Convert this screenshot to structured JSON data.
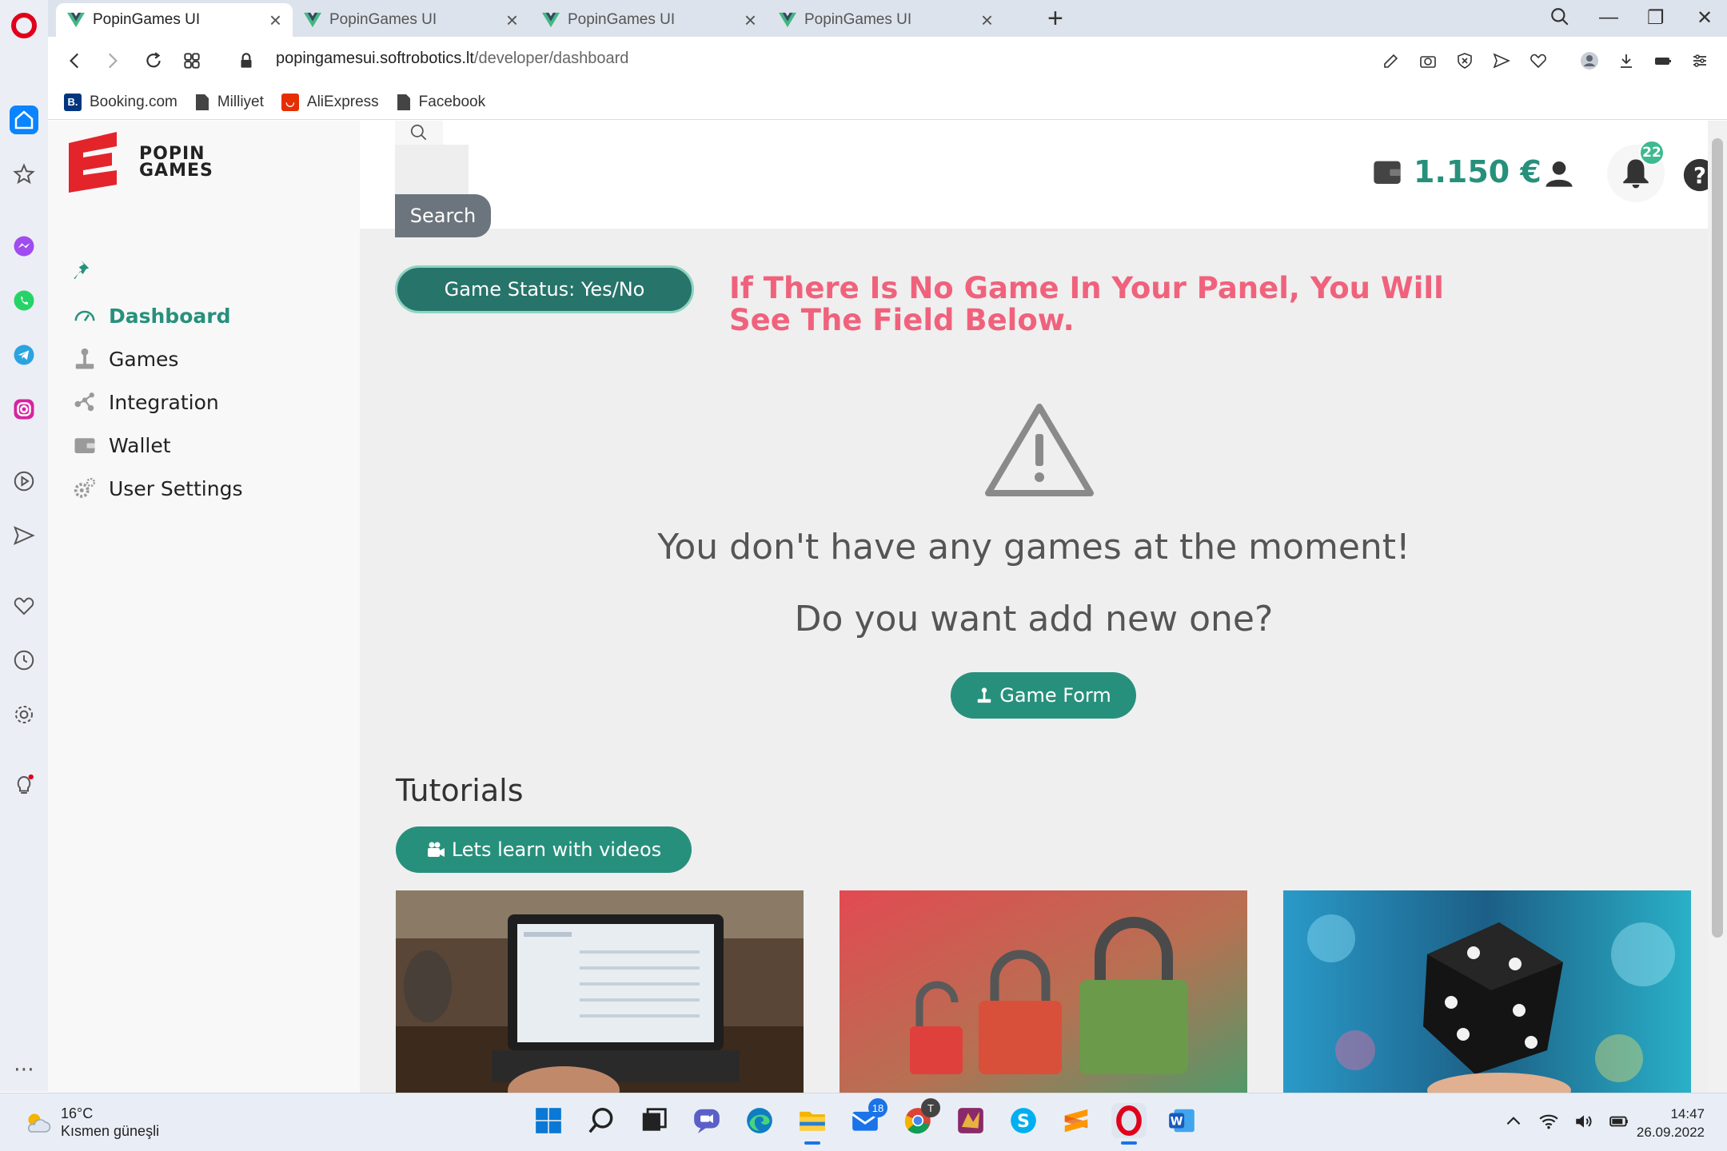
{
  "browser": {
    "tabs": [
      {
        "title": "PopinGames UI",
        "active": true
      },
      {
        "title": "PopinGames UI",
        "active": false
      },
      {
        "title": "PopinGames UI",
        "active": false
      },
      {
        "title": "PopinGames UI",
        "active": false
      }
    ],
    "url_host": "popingamesui.softrobotics.lt",
    "url_path": "/developer/dashboard",
    "bookmarks": [
      {
        "label": "Booking.com",
        "icon": "booking-icon",
        "color": "#003580"
      },
      {
        "label": "Milliyet",
        "icon": "page-icon",
        "color": "#444444"
      },
      {
        "label": "AliExpress",
        "icon": "aliexpress-icon",
        "color": "#e62e04"
      },
      {
        "label": "Facebook",
        "icon": "page-icon",
        "color": "#444444"
      }
    ]
  },
  "app": {
    "logo_line1": "POPIN",
    "logo_line2": "GAMES",
    "brand_color": "#27907c",
    "sidebar": {
      "items": [
        {
          "label": "Dashboard",
          "icon": "gauge-icon",
          "active": true
        },
        {
          "label": "Games",
          "icon": "joystick-icon",
          "active": false
        },
        {
          "label": "Integration",
          "icon": "network-icon",
          "active": false
        },
        {
          "label": "Wallet",
          "icon": "wallet-icon",
          "active": false
        },
        {
          "label": "User Settings",
          "icon": "gears-icon",
          "active": false
        }
      ]
    },
    "header": {
      "search_button": "Search",
      "balance": "1.150 €",
      "notification_count": "22"
    },
    "main": {
      "status_button": "Game Status: Yes/No",
      "note": "If There Is No Game In Your Panel, You Will See The Field Below.",
      "note_color": "#f0627c",
      "empty_title": "You don't have any games at the moment!",
      "empty_subtitle": "Do you want add new one?",
      "game_form_button": "Game Form",
      "tutorials_title": "Tutorials",
      "videos_button": "Lets learn with videos",
      "tutorial_images": [
        "laptop-photo",
        "padlocks-photo",
        "dice-photo"
      ]
    }
  },
  "taskbar": {
    "weather_temp": "16°C",
    "weather_desc": "Kısmen güneşli",
    "mail_badge": "18",
    "chrome_badge": "T",
    "time": "14:47",
    "date": "26.09.2022"
  }
}
